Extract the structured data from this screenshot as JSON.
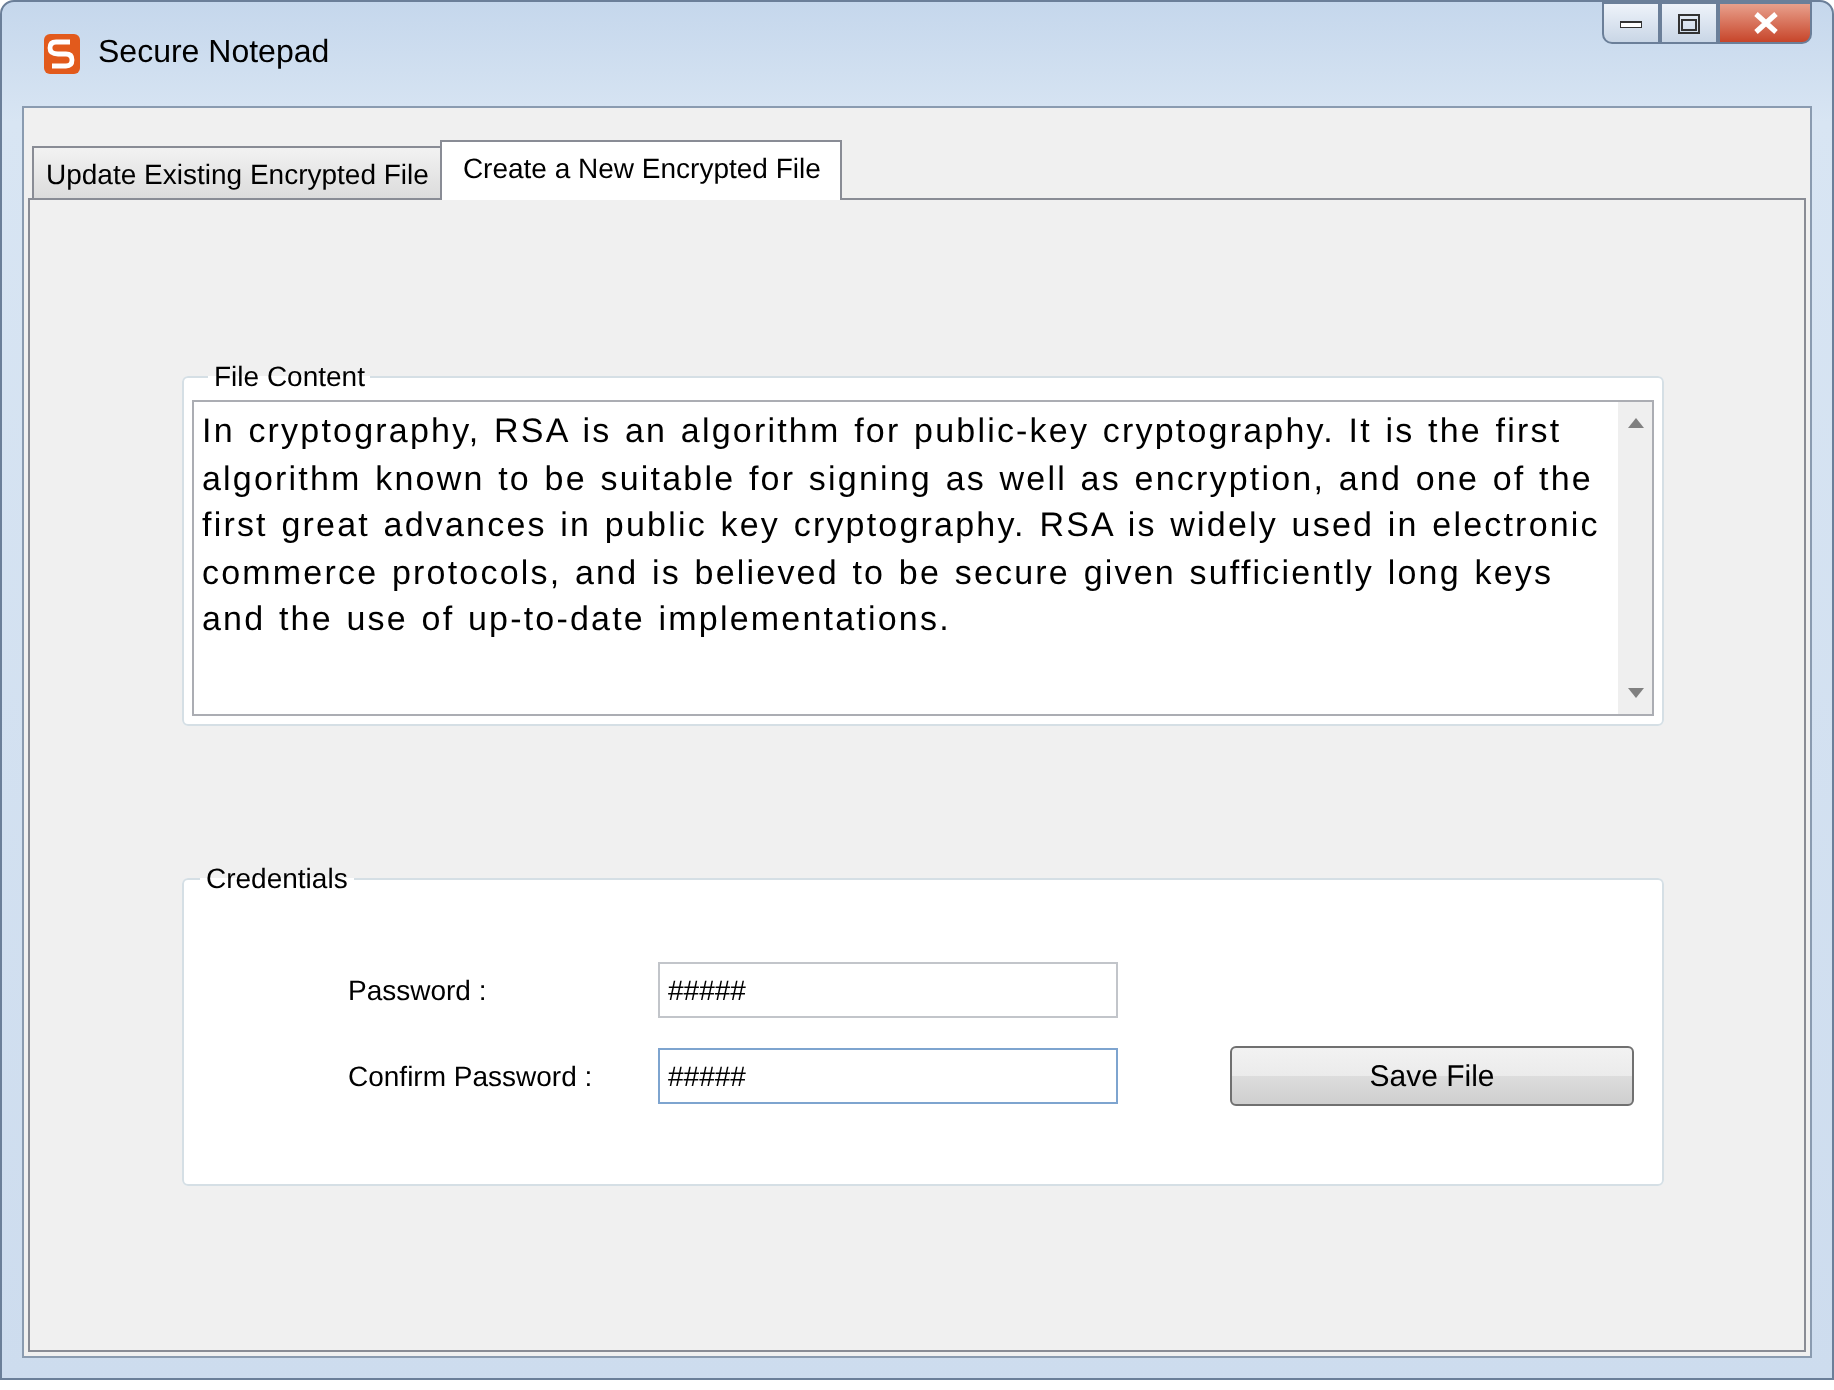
{
  "window": {
    "title": "Secure Notepad"
  },
  "tabs": [
    {
      "label": "Update Existing Encrypted File",
      "selected": false
    },
    {
      "label": "Create a New Encrypted File",
      "selected": true
    }
  ],
  "file_content": {
    "legend": "File Content",
    "value": "In cryptography, RSA is an algorithm for public-key cryptography. It is the first algorithm known to be suitable for signing as well as encryption, and one of the first great advances in public key cryptography. RSA is widely used in electronic commerce protocols, and is believed to be secure given sufficiently long keys and the use of up-to-date implementations."
  },
  "credentials": {
    "legend": "Credentials",
    "fields": [
      {
        "label": "Password :",
        "value": "#####",
        "focused": false
      },
      {
        "label": "Confirm Password :",
        "value": "#####",
        "focused": true
      }
    ],
    "save_button": "Save File"
  }
}
